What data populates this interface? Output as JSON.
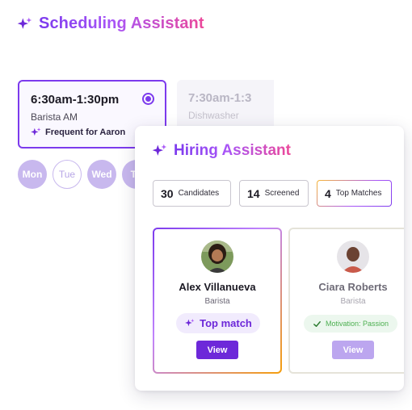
{
  "scheduling": {
    "title": "Scheduling Assistant",
    "shifts": [
      {
        "time": "6:30am-1:30pm",
        "role": "Barista AM",
        "tag": "Frequent for Aaron",
        "selected": true
      },
      {
        "time": "7:30am-1:3",
        "role": "Dishwasher",
        "selected": false
      }
    ],
    "days": [
      {
        "label": "Mon",
        "active": true
      },
      {
        "label": "Tue",
        "active": false
      },
      {
        "label": "Wed",
        "active": true
      },
      {
        "label": "Th",
        "active": true
      }
    ]
  },
  "hiring": {
    "title": "Hiring Assistant",
    "stats": [
      {
        "value": "30",
        "label": "Candidates"
      },
      {
        "value": "14",
        "label": "Screened"
      },
      {
        "value": "4",
        "label": "Top Matches"
      }
    ],
    "candidates": [
      {
        "name": "Alex Villanueva",
        "role": "Barista",
        "badge": "Top match",
        "action": "View"
      },
      {
        "name": "Ciara Roberts",
        "role": "Barista",
        "badge": "Motivation: Passion",
        "action": "View"
      }
    ]
  },
  "colors": {
    "accent": "#7c3aed",
    "accent_dark": "#6d28d9",
    "success": "#4caf50"
  },
  "icons": {
    "sparkle": "sparkle-icon",
    "check": "check-icon",
    "radio": "radio-selected-icon"
  }
}
